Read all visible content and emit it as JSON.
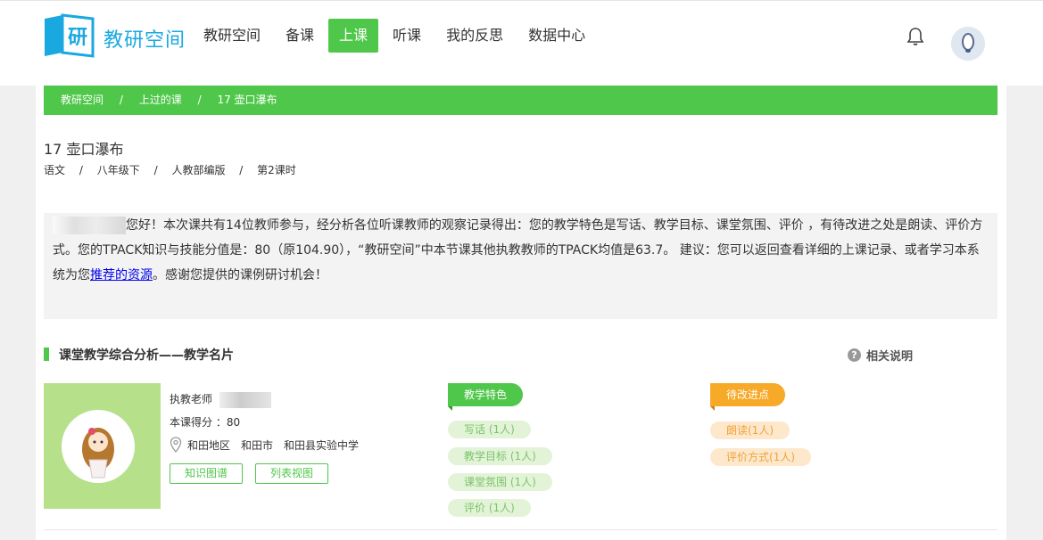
{
  "header": {
    "brand": "教研空间",
    "nav": [
      "教研空间",
      "备课",
      "上课",
      "听课",
      "我的反思",
      "数据中心"
    ],
    "active_nav_index": 2
  },
  "breadcrumb": [
    "教研空间",
    "上过的课",
    "17 壶口瀑布"
  ],
  "breadcrumb_sep": "/",
  "lesson": {
    "title": "17 壶口瀑布",
    "meta": [
      "语文",
      "八年级下",
      "人教部编版",
      "第2课时"
    ],
    "meta_sep": "/"
  },
  "summary": {
    "text1": "您好！本次课共有14位教师参与，经分析各位听课教师的观察记录得出：您的教学特色是写话、教学目标、课堂氛围、评价 ，有待改进之处是朗读、评价方式。您的TPACK知识与技能分值是：80（原104.90），“教研空间”中本节课其他执教教师的TPACK均值是63.7。 建议：您可以返回查看详细的上课记录、或者学习本系统为您",
    "link": "推荐的资源",
    "text2": "。感谢您提供的课例研讨机会！"
  },
  "section": {
    "title": "课堂教学综合分析——教学名片",
    "help": "相关说明"
  },
  "card": {
    "teacher_label": "执教老师",
    "score_text": "本课得分 ：80",
    "location": [
      "和田地区",
      "和田市",
      "和田县实验中学"
    ],
    "btn_knowledge": "知识图谱",
    "btn_list": "列表视图"
  },
  "features": {
    "label": "教学特色",
    "items": [
      "写话 (1人)",
      "教学目标 (1人)",
      "课堂氛围 (1人)",
      "评价 (1人)"
    ]
  },
  "improve": {
    "label": "待改进点",
    "items": [
      "朗读(1人)",
      "评价方式(1人)"
    ]
  },
  "colors": {
    "accent": "#4fc74a",
    "brand": "#1aa8e0",
    "orange": "#f7a928"
  }
}
